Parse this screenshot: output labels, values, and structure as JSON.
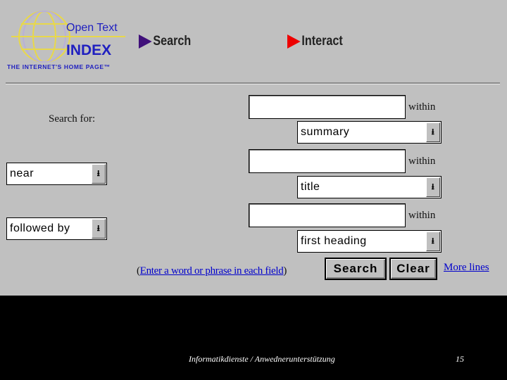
{
  "logo": {
    "line1": "Open Text",
    "line2": "INDEX",
    "tagline": "THE INTERNET'S HOME PAGE™"
  },
  "nav": [
    {
      "label": "Search",
      "color": "#40107a"
    },
    {
      "label": "Interact",
      "color": "#ee0000"
    }
  ],
  "form": {
    "search_for_label": "Search for:",
    "within_label": "within",
    "rows": [
      {
        "value": "",
        "within": "summary"
      },
      {
        "operator": "near",
        "value": "",
        "within": "title"
      },
      {
        "operator": "followed by",
        "value": "",
        "within": "first heading"
      }
    ],
    "hint_open": "(",
    "hint_link": "Enter a word or phrase in each field",
    "hint_close": ")",
    "search_button": "Search",
    "clear_button": "Clear",
    "more_lines": "More lines"
  },
  "footer": {
    "text": "Informatikdienste / Anwednerunterstützung",
    "page": "15"
  }
}
